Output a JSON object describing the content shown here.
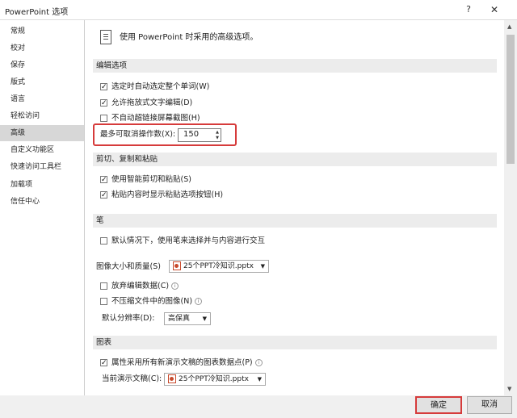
{
  "window": {
    "title": "PowerPoint 选项",
    "help": "?",
    "close": "✕"
  },
  "sidebar": {
    "items": [
      "常规",
      "校对",
      "保存",
      "版式",
      "语言",
      "轻松访问",
      "高级",
      "自定义功能区",
      "快速访问工具栏",
      "加载项",
      "信任中心"
    ],
    "active": "高级"
  },
  "intro": "使用 PowerPoint 时采用的高级选项。",
  "editing": {
    "header": "编辑选项",
    "auto_select_word": {
      "label": "选定时自动选定整个单词(W)",
      "checked": true
    },
    "drag_drop": {
      "label": "允许拖放式文字编辑(D)",
      "checked": true
    },
    "no_hyperlink_screenshot": {
      "label": "不自动超链接屏幕截图(H)",
      "checked": false
    },
    "undo_label": "最多可取消操作数(X):",
    "undo_value": "150"
  },
  "clipboard": {
    "header": "剪切、复制和粘贴",
    "smart_cut": {
      "label": "使用智能剪切和粘贴(S)",
      "checked": true
    },
    "paste_options": {
      "label": "粘贴内容时显示粘贴选项按钮(H)",
      "checked": true
    }
  },
  "pen": {
    "header": "笔",
    "pen_select": {
      "label": "默认情况下，使用笔来选择并与内容进行交互",
      "checked": false
    }
  },
  "image": {
    "header": "图像大小和质量(S)",
    "file": "25个PPT冷知识.pptx",
    "discard_edit": {
      "label": "放弃编辑数据(C)",
      "checked": false
    },
    "no_compress": {
      "label": "不压缩文件中的图像(N)",
      "checked": false
    },
    "resolution_label": "默认分辨率(D):",
    "resolution_value": "高保真"
  },
  "chart": {
    "header": "图表",
    "properties_follow": {
      "label": "属性采用所有新演示文稿的图表数据点(P)",
      "checked": true
    },
    "current_doc_label": "当前演示文稿(C):",
    "current_doc_value": "25个PPT冷知识.pptx"
  },
  "buttons": {
    "ok": "确定",
    "cancel": "取消"
  },
  "colors": {
    "highlight_border": "#d63b3b",
    "active_nav": "#d7d7d7"
  }
}
